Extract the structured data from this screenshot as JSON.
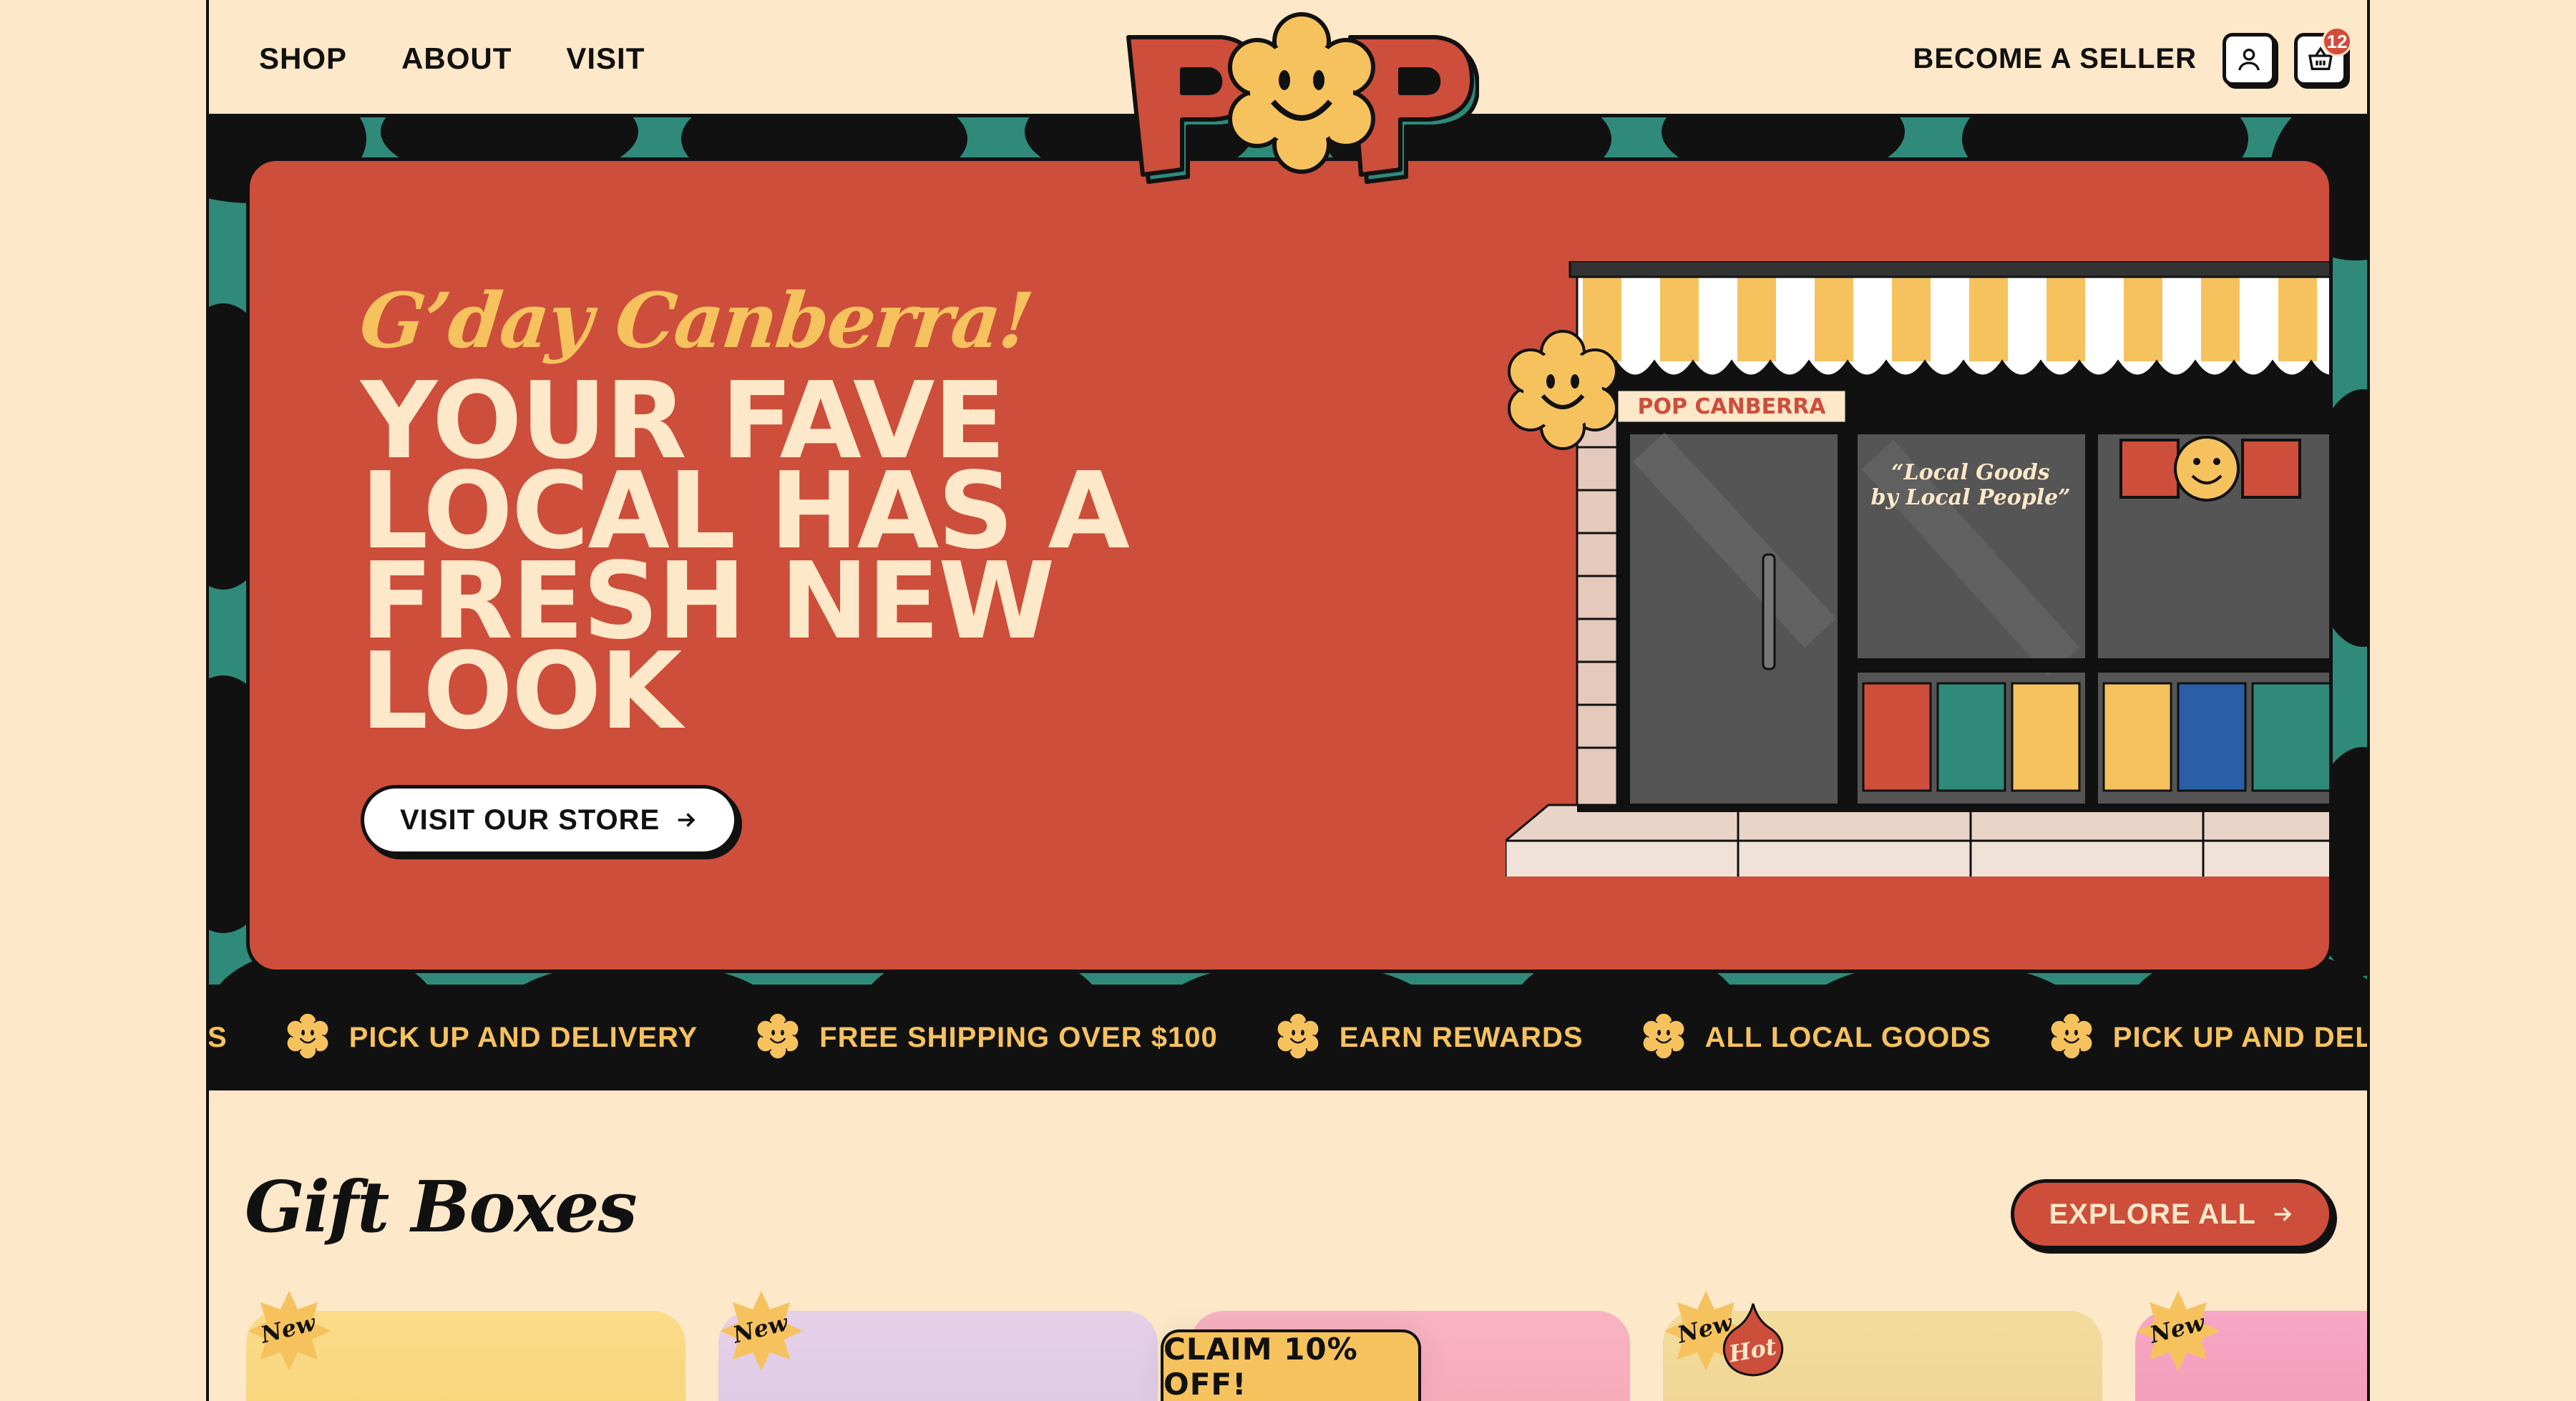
{
  "nav": {
    "shop": "SHOP",
    "about": "ABOUT",
    "visit": "VISIT"
  },
  "header": {
    "seller": "BECOME A SELLER",
    "cart_count": "12"
  },
  "logo": {
    "text": "POP"
  },
  "hero": {
    "greeting": "G’day Canberra!",
    "headline_1": "YOUR FAVE",
    "headline_2": "LOCAL HAS A",
    "headline_3": "FRESH NEW",
    "headline_4": "LOOK",
    "cta": "VISIT OUR STORE",
    "store_sign": "POP CANBERRA",
    "window_quote_1": "“Local Goods",
    "window_quote_2": "by Local People”"
  },
  "ticker": [
    "ODS",
    "PICK UP AND DELIVERY",
    "FREE SHIPPING OVER $100",
    "EARN REWARDS",
    "ALL LOCAL GOODS",
    "PICK UP AND DELIVER"
  ],
  "gifts": {
    "title": "Gift Boxes",
    "explore": "EXPLORE ALL"
  },
  "tags": {
    "new": "New",
    "hot": "Hot"
  },
  "promo": {
    "claim": "CLAIM 10% OFF!"
  },
  "colors": {
    "cream": "#fde8c9",
    "red": "#cd4e3b",
    "yellow": "#f6c25e",
    "teal": "#2f8a7a",
    "black": "#111111"
  }
}
